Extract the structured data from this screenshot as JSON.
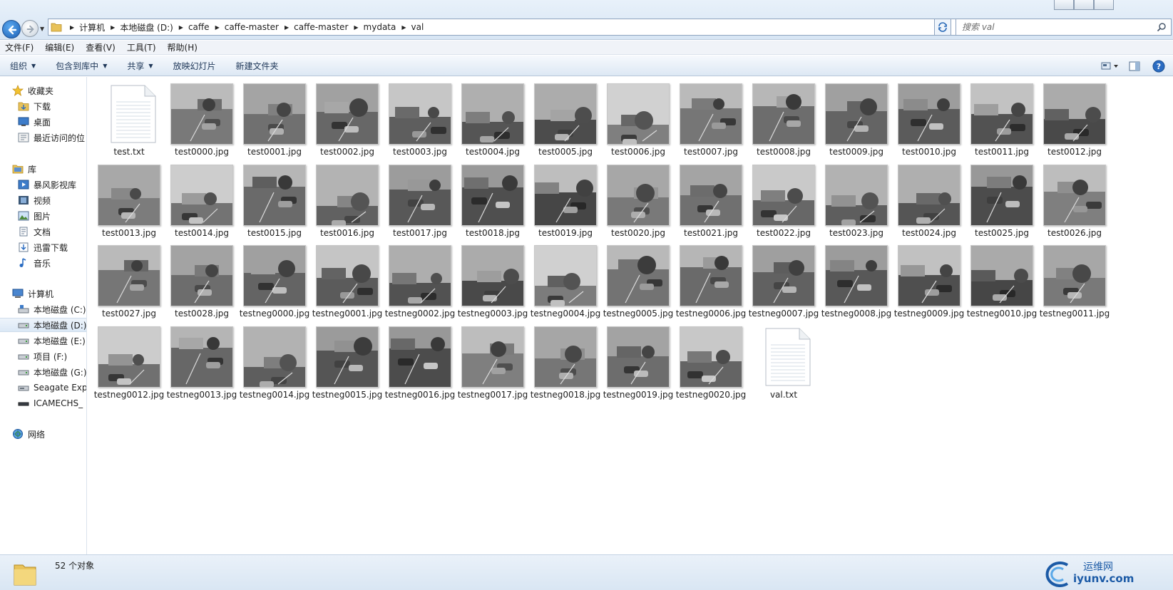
{
  "window": {
    "address": {
      "breadcrumbs": [
        "计算机",
        "本地磁盘 (D:)",
        "caffe",
        "caffe-master",
        "caffe-master",
        "mydata",
        "val"
      ]
    },
    "search": {
      "placeholder": "搜索 val"
    }
  },
  "menubar": {
    "items": [
      "文件(F)",
      "编辑(E)",
      "查看(V)",
      "工具(T)",
      "帮助(H)"
    ]
  },
  "toolbar": {
    "organize": "组织",
    "include_in_library": "包含到库中",
    "share": "共享",
    "slideshow": "放映幻灯片",
    "new_folder": "新建文件夹"
  },
  "nav": {
    "favorites": {
      "label": "收藏夹",
      "items": [
        "下载",
        "桌面",
        "最近访问的位"
      ]
    },
    "libraries": {
      "label": "库",
      "items": [
        "暴风影视库",
        "视频",
        "图片",
        "文档",
        "迅雷下载",
        "音乐"
      ]
    },
    "computer": {
      "label": "计算机",
      "items": [
        "本地磁盘 (C:)",
        "本地磁盘 (D:)",
        "本地磁盘 (E:)",
        "项目 (F:)",
        "本地磁盘 (G:)",
        "Seagate Exp",
        "ICAMECHS_"
      ]
    },
    "network": {
      "label": "网络"
    },
    "selected": "本地磁盘 (D:)"
  },
  "files": [
    {
      "name": "test.txt",
      "kind": "text"
    },
    {
      "name": "test0000.jpg",
      "kind": "image"
    },
    {
      "name": "test0001.jpg",
      "kind": "image"
    },
    {
      "name": "test0002.jpg",
      "kind": "image"
    },
    {
      "name": "test0003.jpg",
      "kind": "image"
    },
    {
      "name": "test0004.jpg",
      "kind": "image"
    },
    {
      "name": "test0005.jpg",
      "kind": "image"
    },
    {
      "name": "test0006.jpg",
      "kind": "image"
    },
    {
      "name": "test0007.jpg",
      "kind": "image"
    },
    {
      "name": "test0008.jpg",
      "kind": "image"
    },
    {
      "name": "test0009.jpg",
      "kind": "image"
    },
    {
      "name": "test0010.jpg",
      "kind": "image"
    },
    {
      "name": "test0011.jpg",
      "kind": "image"
    },
    {
      "name": "test0012.jpg",
      "kind": "image"
    },
    {
      "name": "test0013.jpg",
      "kind": "image"
    },
    {
      "name": "test0014.jpg",
      "kind": "image"
    },
    {
      "name": "test0015.jpg",
      "kind": "image"
    },
    {
      "name": "test0016.jpg",
      "kind": "image"
    },
    {
      "name": "test0017.jpg",
      "kind": "image"
    },
    {
      "name": "test0018.jpg",
      "kind": "image"
    },
    {
      "name": "test0019.jpg",
      "kind": "image"
    },
    {
      "name": "test0020.jpg",
      "kind": "image"
    },
    {
      "name": "test0021.jpg",
      "kind": "image"
    },
    {
      "name": "test0022.jpg",
      "kind": "image"
    },
    {
      "name": "test0023.jpg",
      "kind": "image"
    },
    {
      "name": "test0024.jpg",
      "kind": "image"
    },
    {
      "name": "test0025.jpg",
      "kind": "image"
    },
    {
      "name": "test0026.jpg",
      "kind": "image"
    },
    {
      "name": "test0027.jpg",
      "kind": "image"
    },
    {
      "name": "test0028.jpg",
      "kind": "image"
    },
    {
      "name": "testneg0000.jpg",
      "kind": "image"
    },
    {
      "name": "testneg0001.jpg",
      "kind": "image"
    },
    {
      "name": "testneg0002.jpg",
      "kind": "image"
    },
    {
      "name": "testneg0003.jpg",
      "kind": "image"
    },
    {
      "name": "testneg0004.jpg",
      "kind": "image"
    },
    {
      "name": "testneg0005.jpg",
      "kind": "image"
    },
    {
      "name": "testneg0006.jpg",
      "kind": "image"
    },
    {
      "name": "testneg0007.jpg",
      "kind": "image"
    },
    {
      "name": "testneg0008.jpg",
      "kind": "image"
    },
    {
      "name": "testneg0009.jpg",
      "kind": "image"
    },
    {
      "name": "testneg0010.jpg",
      "kind": "image"
    },
    {
      "name": "testneg0011.jpg",
      "kind": "image"
    },
    {
      "name": "testneg0012.jpg",
      "kind": "image"
    },
    {
      "name": "testneg0013.jpg",
      "kind": "image"
    },
    {
      "name": "testneg0014.jpg",
      "kind": "image"
    },
    {
      "name": "testneg0015.jpg",
      "kind": "image"
    },
    {
      "name": "testneg0016.jpg",
      "kind": "image"
    },
    {
      "name": "testneg0017.jpg",
      "kind": "image"
    },
    {
      "name": "testneg0018.jpg",
      "kind": "image"
    },
    {
      "name": "testneg0019.jpg",
      "kind": "image"
    },
    {
      "name": "testneg0020.jpg",
      "kind": "image"
    },
    {
      "name": "val.txt",
      "kind": "text"
    }
  ],
  "status": {
    "count_text": "52 个对象"
  },
  "watermark": {
    "line1": "运维网",
    "line2": "iyunv.com"
  },
  "colors": {
    "accent": "#1b5aa6",
    "selection": "#dbe8f6"
  }
}
